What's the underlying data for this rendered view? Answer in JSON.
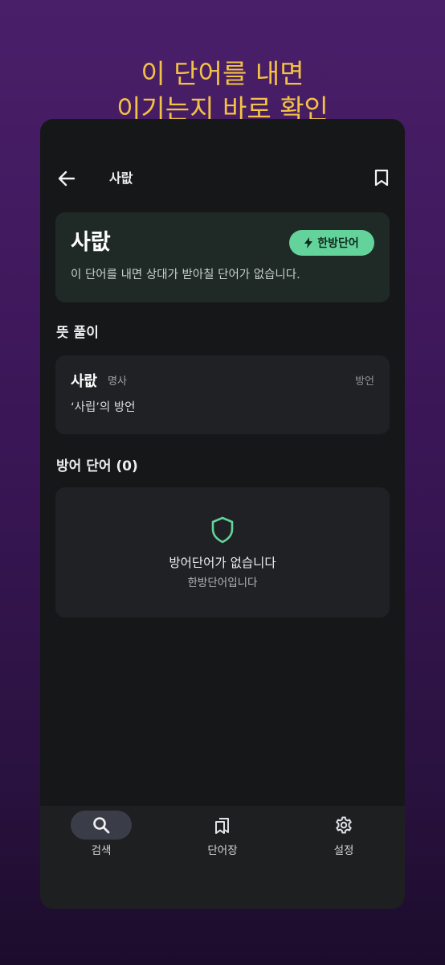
{
  "promo": {
    "line1": "이 단어를 내면",
    "line2": "이기는지 바로 확인"
  },
  "appbar": {
    "back_icon": "arrow-left-icon",
    "title": "사랎",
    "bookmark_icon": "bookmark-icon"
  },
  "word_card": {
    "word": "사랎",
    "badge_icon": "lightning-icon",
    "badge_label": "한방단어",
    "description": "이 단어를 내면 상대가 받아칠 단어가 없습니다."
  },
  "meaning_section": {
    "title": "뜻 풀이",
    "entries": [
      {
        "word": "사랎",
        "pos": "명사",
        "tag": "방언",
        "definition": "‘사립’의 방언"
      }
    ]
  },
  "defense_section": {
    "title": "방어 단어 (0)",
    "empty_icon": "shield-icon",
    "empty_title": "방어단어가 없습니다",
    "empty_sub": "한방단어입니다"
  },
  "bottom_nav": {
    "items": [
      {
        "icon": "search-icon",
        "label": "검색",
        "active": true
      },
      {
        "icon": "bookmarks-icon",
        "label": "단어장",
        "active": false
      },
      {
        "icon": "gear-icon",
        "label": "설정",
        "active": false
      }
    ]
  },
  "colors": {
    "accent": "#63d39b",
    "headline": "#f3c244",
    "background_top": "#4a1f6a",
    "screen_bg": "#161719"
  }
}
